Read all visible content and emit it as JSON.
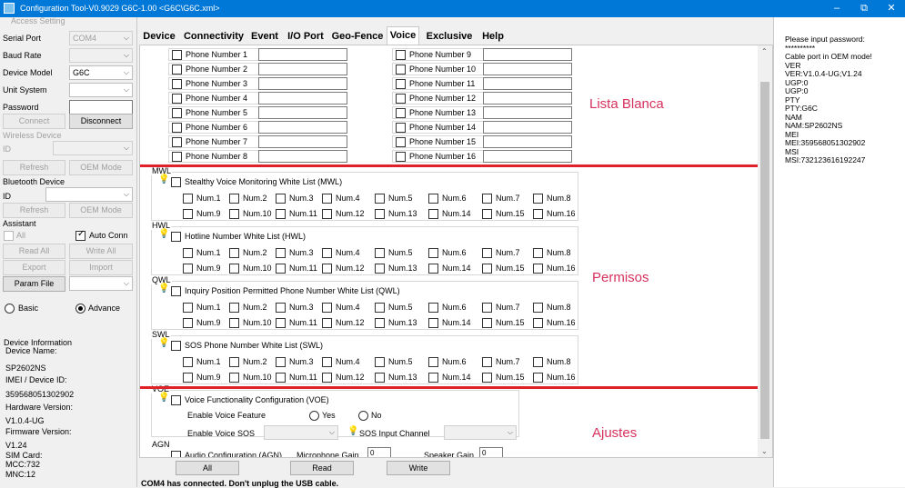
{
  "window": {
    "title": "Configuration Tool-V0.9029 G6C-1.00 <G6C\\G6C.xml>",
    "minimize": "–",
    "maximize": "⧉",
    "close": "✕"
  },
  "sidebar": {
    "access_setting": "Access Setting",
    "serial_port_label": "Serial Port",
    "serial_port_value": "COM4",
    "baud_rate_label": "Baud Rate",
    "device_model_label": "Device Model",
    "device_model_value": "G6C",
    "unit_system_label": "Unit System",
    "password_label": "Password",
    "connect_button": "Connect",
    "disconnect_button": "Disconnect",
    "wireless_device": "Wireless Device",
    "wireless_id_label": "ID",
    "refresh_button_1": "Refresh",
    "oem_mode_button_1": "OEM Mode",
    "bluetooth_device": "Bluetooth Device",
    "bluetooth_id_label": "ID",
    "refresh_button_2": "Refresh",
    "oem_mode_button_2": "OEM Mode",
    "assistant": "Assistant",
    "all_label": "All",
    "auto_conn_label": "Auto Conn",
    "read_all_button": "Read All",
    "write_all_button": "Write All",
    "export_button": "Export",
    "import_button": "Import",
    "param_file_button": "Param File",
    "basic_label": "Basic",
    "advance_label": "Advance",
    "device_info": "Device Information",
    "device_name_label": "Device Name:",
    "device_name_value": "SP2602NS",
    "imei_label": "IMEI / Device ID:",
    "imei_value": "359568051302902",
    "hw_label": "Hardware Version:",
    "hw_value": "V1.0.4-UG",
    "fw_label": "Firmware Version:",
    "fw_value": "V1.24",
    "sim_label": "SIM Card:",
    "mcc": "MCC:732",
    "mnc": "MNC:12"
  },
  "tabs": [
    "Device",
    "Connectivity",
    "Event",
    "I/O Port",
    "Geo-Fence",
    "Voice",
    "Exclusive",
    "Help"
  ],
  "phones_left": [
    "Phone Number 1",
    "Phone Number 2",
    "Phone Number 3",
    "Phone Number 4",
    "Phone Number 5",
    "Phone Number 6",
    "Phone Number 7",
    "Phone Number 8"
  ],
  "phones_right": [
    "Phone Number 9",
    "Phone Number 10",
    "Phone Number 11",
    "Phone Number 12",
    "Phone Number 13",
    "Phone Number 14",
    "Phone Number 15",
    "Phone Number 16"
  ],
  "nums_row1": [
    "Num.1",
    "Num.2",
    "Num.3",
    "Num.4",
    "Num.5",
    "Num.6",
    "Num.7",
    "Num.8"
  ],
  "nums_row2": [
    "Num.9",
    "Num.10",
    "Num.11",
    "Num.12",
    "Num.13",
    "Num.14",
    "Num.15",
    "Num.16"
  ],
  "groups": {
    "mwl_tag": "MWL",
    "mwl_title": "Stealthy Voice Monitoring White List (MWL)",
    "hwl_tag": "HWL",
    "hwl_title": "Hotline Number White List (HWL)",
    "qwl_tag": "QWL",
    "qwl_title": "Inquiry Position Permitted Phone Number White List (QWL)",
    "swl_tag": "SWL",
    "swl_title": "SOS Phone Number White List (SWL)",
    "voe_tag": "VOE",
    "voe_title": "Voice Functionality Configuration (VOE)",
    "enable_voice_feature": "Enable Voice Feature",
    "yes": "Yes",
    "no": "No",
    "enable_voice_sos": "Enable Voice SOS",
    "sos_input_channel": "SOS Input Channel",
    "agn_tag": "AGN",
    "agn_title": "Audio Configuration (AGN)",
    "microphone_gain": "Microphone Gain",
    "mic_value": "0",
    "speaker_gain": "Speaker Gain",
    "spk_value": "0"
  },
  "annotations": {
    "lista_blanca": "Lista Blanca",
    "permisos": "Permisos",
    "ajustes": "Ajustes"
  },
  "bottom": {
    "all_button": "All",
    "read_button": "Read",
    "write_button": "Write",
    "status": "COM4 has connected. Don't unplug the USB cable."
  },
  "log_lines": [
    "Please input password:",
    "**********",
    "Cable port in OEM mode!",
    "VER",
    "VER:V1.0.4-UG;V1.24",
    "UGP:0",
    "UGP:0",
    "PTY",
    "PTY:G6C",
    "NAM",
    "NAM:SP2602NS",
    "MEI",
    "MEI:359568051302902",
    "MSI",
    "MSI:732123616192247"
  ],
  "colors": {
    "titlebar": "#0078d7",
    "annotation": "#d6315f",
    "redline": "#e0212a"
  }
}
